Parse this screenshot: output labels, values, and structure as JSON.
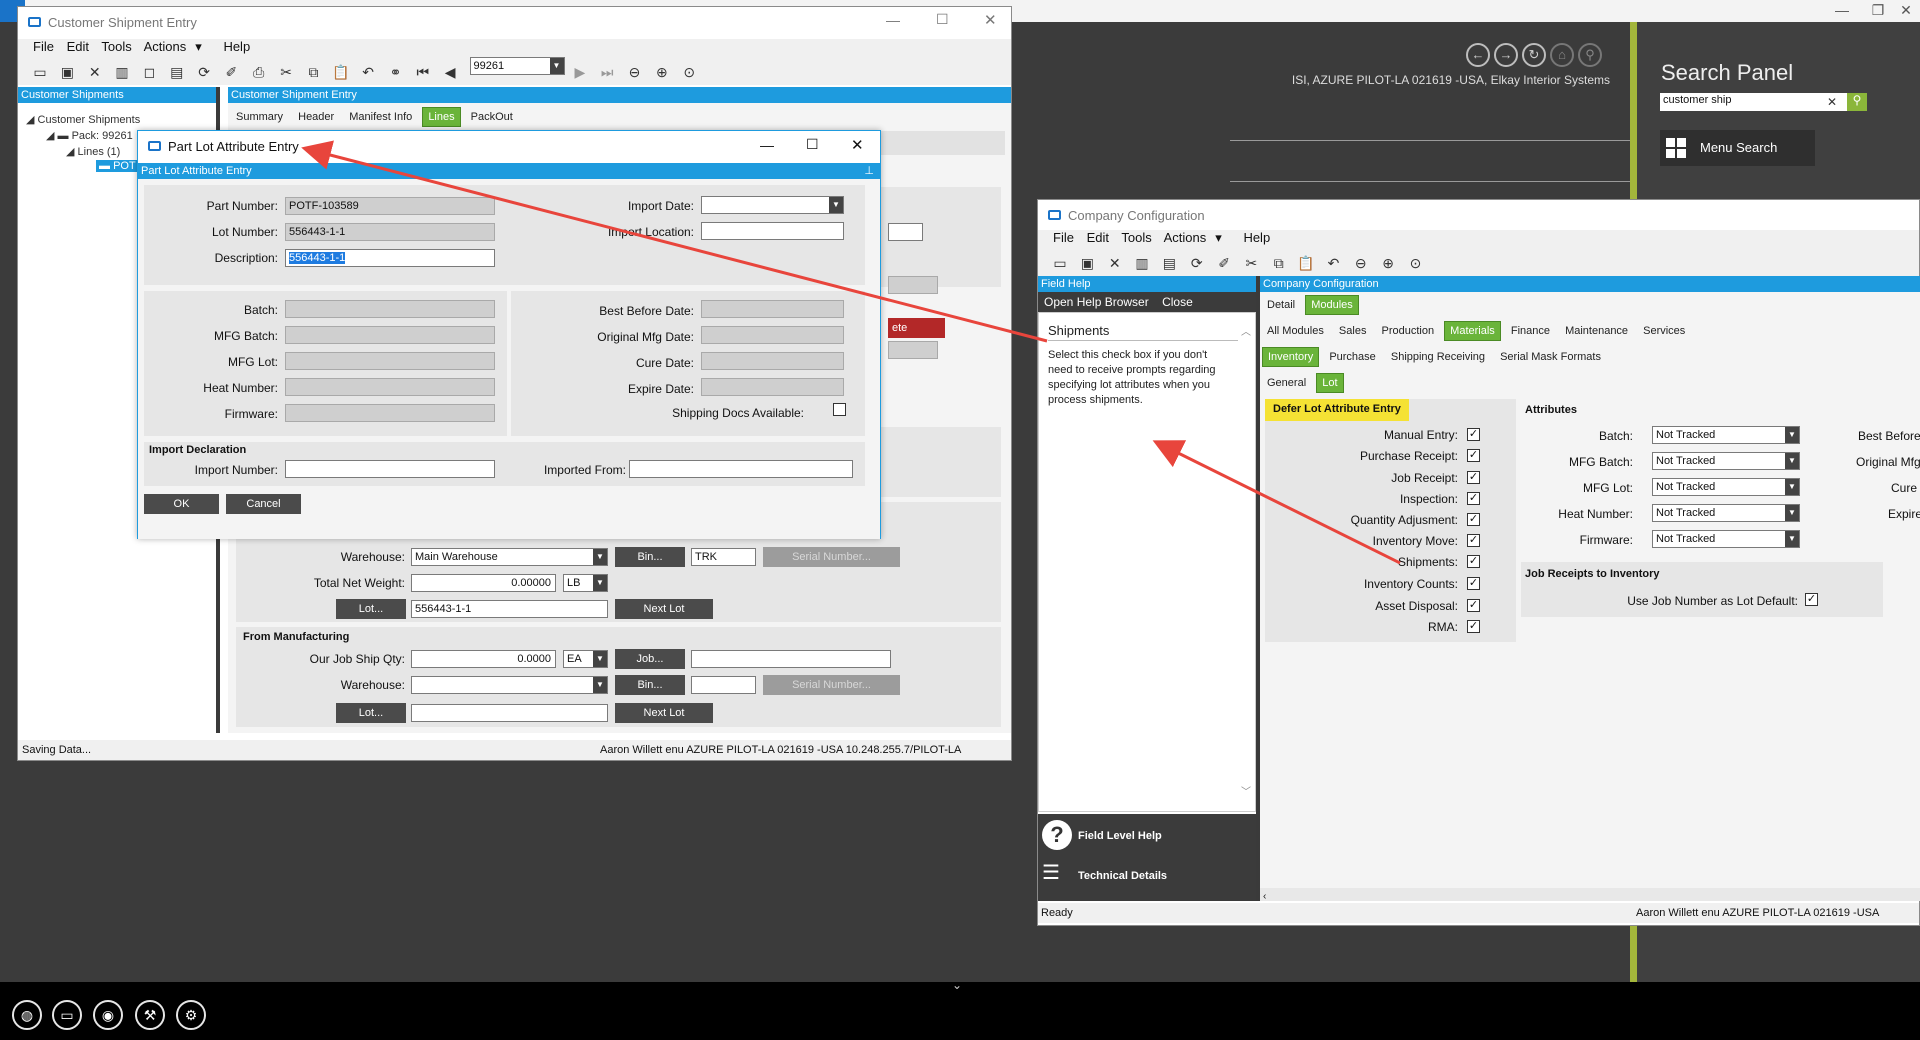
{
  "desktop": {
    "user_info": "ISI, AZURE PILOT-LA 021619  -USA, Elkay Interior Systems",
    "search_panel": {
      "title": "Search Panel",
      "query": "customer ship",
      "menu_search_label": "Menu Search"
    },
    "taskbar_icons": [
      "globe-icon",
      "monitor-icon",
      "lightbulb-icon",
      "wrench-icon",
      "settings-search-icon"
    ]
  },
  "shipment_window": {
    "title": "Customer Shipment Entry",
    "menu": [
      "File",
      "Edit",
      "Tools",
      "Actions",
      "Help"
    ],
    "actions_arrow": "▾",
    "pack_number": "99261",
    "tree_header": "Customer Shipments",
    "tree": [
      "Customer Shipments",
      "Pack: 99261",
      "Lines (1)",
      "POT"
    ],
    "main_header": "Customer Shipment Entry",
    "tabs": [
      "Summary",
      "Header",
      "Manifest Info",
      "Lines",
      "PackOut"
    ],
    "active_tab": "Lines",
    "delete_fragment": "ete",
    "warehouse_label": "Warehouse:",
    "warehouse_value": "Main Warehouse",
    "bin_label": "Bin...",
    "bin_value": "TRK",
    "serial_label": "Serial Number...",
    "total_net_weight_label": "Total Net Weight:",
    "total_net_weight": "0.00000",
    "weight_uom": "LB",
    "lot_button": "Lot...",
    "lot_value": "556443-1-1",
    "next_lot": "Next Lot",
    "from_manufacturing": "From Manufacturing",
    "our_job_ship_qty_label": "Our Job Ship Qty:",
    "our_job_ship_qty": "0.0000",
    "qty_uom": "EA",
    "job_button": "Job...",
    "mfg_warehouse_label": "Warehouse:",
    "status": {
      "left": "Saving Data...",
      "right": "Aaron Willett  enu  AZURE PILOT-LA 021619  -USA      10.248.255.7/PILOT-LA"
    }
  },
  "part_lot_dialog": {
    "title": "Part Lot Attribute Entry",
    "header": "Part Lot Attribute Entry",
    "part_number_label": "Part Number:",
    "part_number": "POTF-103589",
    "lot_number_label": "Lot Number:",
    "lot_number": "556443-1-1",
    "description_label": "Description:",
    "description": "556443-1-1",
    "import_date_label": "Import Date:",
    "import_location_label": "Import Location:",
    "batch_label": "Batch:",
    "mfg_batch_label": "MFG Batch:",
    "mfg_lot_label": "MFG Lot:",
    "heat_number_label": "Heat Number:",
    "firmware_label": "Firmware:",
    "best_before_label": "Best Before Date:",
    "original_mfg_label": "Original Mfg Date:",
    "cure_date_label": "Cure Date:",
    "expire_date_label": "Expire Date:",
    "shipping_docs_label": "Shipping Docs Available:",
    "shipping_docs_checked": false,
    "import_declaration": "Import Declaration",
    "import_number_label": "Import Number:",
    "imported_from_label": "Imported From:",
    "ok": "OK",
    "cancel": "Cancel"
  },
  "company_window": {
    "title": "Company Configuration",
    "menu": [
      "File",
      "Edit",
      "Tools",
      "Actions",
      "Help"
    ],
    "actions_arrow": "▾",
    "field_help": {
      "header": "Field Help",
      "open_help_browser": "Open Help Browser",
      "close": "Close",
      "topic": "Shipments",
      "text": "Select this check box if you don't need to receive prompts regarding specifying lot attributes when you process shipments.",
      "field_level_help": "Field Level Help",
      "technical_details": "Technical Details"
    },
    "config_header": "Company Configuration",
    "tabs1": [
      "Detail",
      "Modules"
    ],
    "tabs2": [
      "All Modules",
      "Sales",
      "Production",
      "Materials",
      "Finance",
      "Maintenance",
      "Services"
    ],
    "tabs3": [
      "Inventory",
      "Purchase",
      "Shipping Receiving",
      "Serial Mask Formats"
    ],
    "tabs4": [
      "General",
      "Lot"
    ],
    "defer_title": "Defer Lot Attribute Entry",
    "defer_items": [
      {
        "label": "Manual Entry:",
        "checked": true
      },
      {
        "label": "Purchase Receipt:",
        "checked": true
      },
      {
        "label": "Job Receipt:",
        "checked": true
      },
      {
        "label": "Inspection:",
        "checked": true
      },
      {
        "label": "Quantity Adjusment:",
        "checked": true
      },
      {
        "label": "Inventory Move:",
        "checked": true
      },
      {
        "label": "Shipments:",
        "checked": true
      },
      {
        "label": "Inventory Counts:",
        "checked": true
      },
      {
        "label": "Asset Disposal:",
        "checked": true
      },
      {
        "label": "RMA:",
        "checked": true
      }
    ],
    "attributes_title": "Attributes",
    "attributes": [
      {
        "label": "Batch:",
        "value": "Not Tracked"
      },
      {
        "label": "MFG Batch:",
        "value": "Not Tracked"
      },
      {
        "label": "MFG Lot:",
        "value": "Not Tracked"
      },
      {
        "label": "Heat Number:",
        "value": "Not Tracked"
      },
      {
        "label": "Firmware:",
        "value": "Not Tracked"
      }
    ],
    "attributes_right": [
      "Best Before",
      "Original Mfg",
      "Cure",
      "Expire"
    ],
    "job_receipts_title": "Job Receipts to Inventory",
    "use_job_number_label": "Use Job Number as Lot Default:",
    "use_job_number_checked": true,
    "status": {
      "left": "Ready",
      "right": "Aaron Willett  enu  AZURE PILOT-LA 021619  -USA"
    }
  },
  "colors": {
    "accent_green": "#6ab43a",
    "header_blue": "#1e9bde",
    "highlight_yellow": "#f5e234",
    "arrow_red": "#e8453c"
  }
}
